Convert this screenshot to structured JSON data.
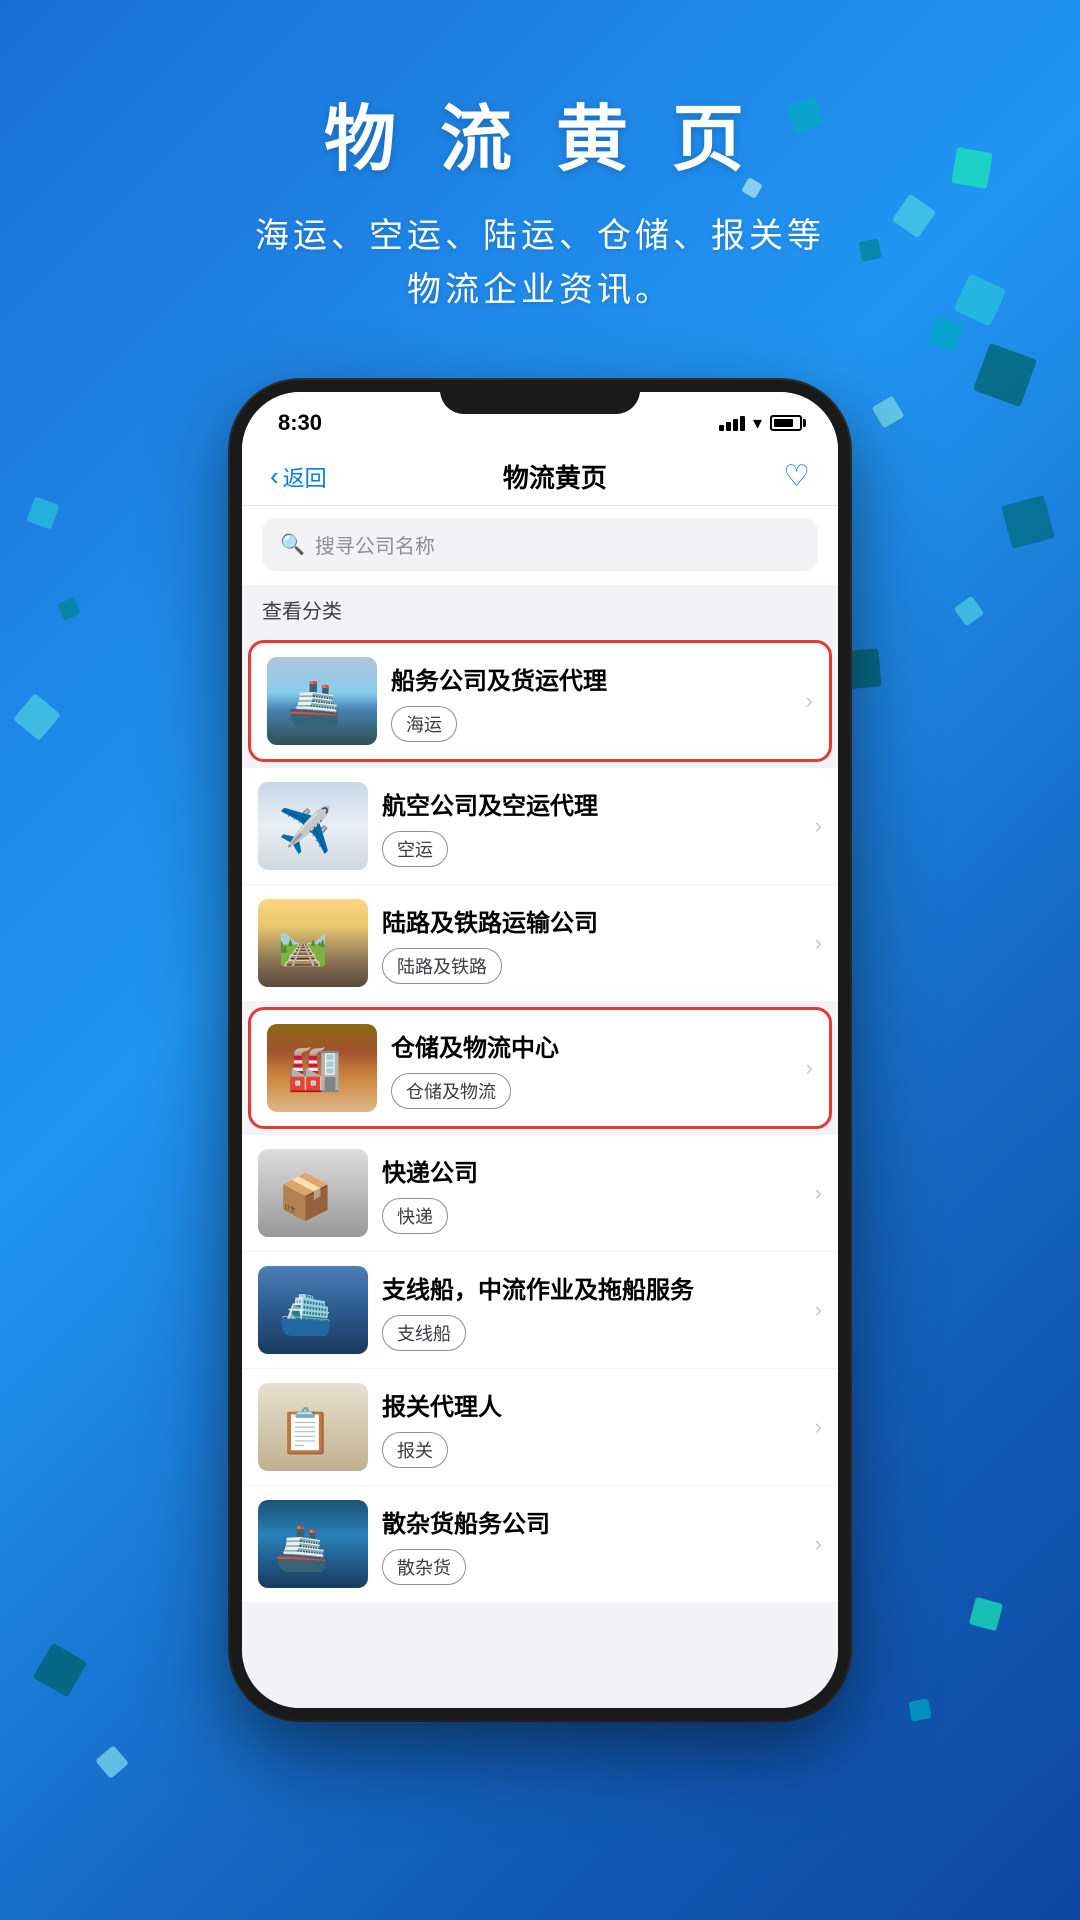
{
  "background": {
    "gradient_start": "#1a6fd4",
    "gradient_end": "#0d47a1"
  },
  "header": {
    "title": "物 流 黄 页",
    "subtitle_line1": "海运、空运、陆运、仓储、报关等",
    "subtitle_line2": "物流企业资讯。"
  },
  "phone": {
    "status_bar": {
      "time": "8:30"
    },
    "nav": {
      "back_label": "返回",
      "title": "物流黄页",
      "favorite_icon": "heart-icon"
    },
    "search": {
      "placeholder": "搜寻公司名称"
    },
    "category_section": {
      "label": "查看分类"
    },
    "list_items": [
      {
        "id": "shipping",
        "title": "船务公司及货运代理",
        "tag": "海运",
        "image_type": "ship",
        "highlighted": true
      },
      {
        "id": "airline",
        "title": "航空公司及空运代理",
        "tag": "空运",
        "image_type": "plane",
        "highlighted": false
      },
      {
        "id": "land",
        "title": "陆路及铁路运输公司",
        "tag": "陆路及铁路",
        "image_type": "rail",
        "highlighted": false
      },
      {
        "id": "warehouse",
        "title": "仓储及物流中心",
        "tag": "仓储及物流",
        "image_type": "warehouse",
        "highlighted": true
      },
      {
        "id": "courier",
        "title": "快递公司",
        "tag": "快递",
        "image_type": "courier",
        "highlighted": false
      },
      {
        "id": "feeder",
        "title": "支线船，中流作业及拖船服务",
        "tag": "支线船",
        "image_type": "feeder",
        "highlighted": false
      },
      {
        "id": "customs",
        "title": "报关代理人",
        "tag": "报关",
        "image_type": "customs",
        "highlighted": false
      },
      {
        "id": "bulk",
        "title": "散杂货船务公司",
        "tag": "散杂货",
        "image_type": "bulk",
        "highlighted": false
      }
    ]
  }
}
